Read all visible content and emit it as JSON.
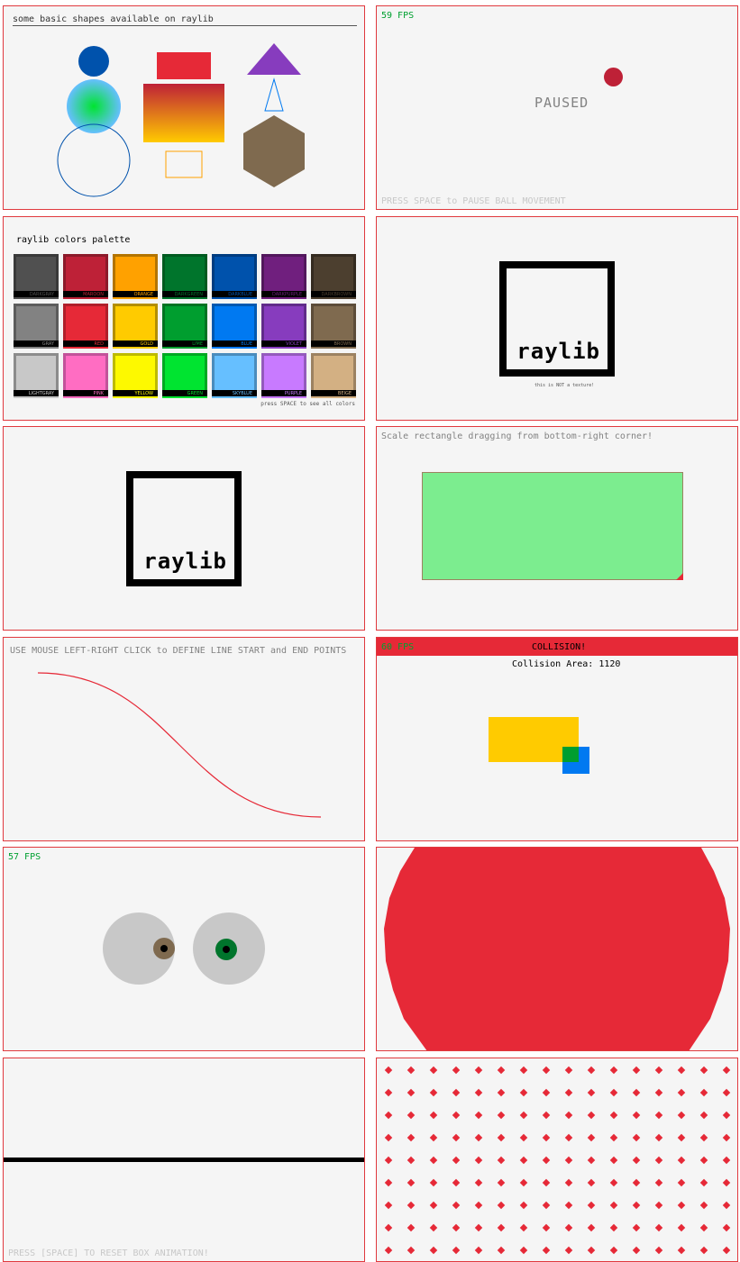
{
  "panels": {
    "shapes": {
      "title": "some basic shapes available on raylib"
    },
    "bouncing_ball": {
      "fps": "59 FPS",
      "paused": "PAUSED",
      "hint": "PRESS SPACE to PAUSE BALL MOVEMENT"
    },
    "palette": {
      "title": "raylib colors palette",
      "hint": "press SPACE to see all colors",
      "colors": [
        {
          "name": "DARKGRAY",
          "fill": "#505050",
          "border": "#3a3a3a",
          "label_color": "#505050"
        },
        {
          "name": "MAROON",
          "fill": "#be2137",
          "border": "#8c1a2a",
          "label_color": "#be2137"
        },
        {
          "name": "ORANGE",
          "fill": "#ffa100",
          "border": "#b37400",
          "label_color": "#ffa100"
        },
        {
          "name": "DARKGREEN",
          "fill": "#00752c",
          "border": "#005a20",
          "label_color": "#00752c"
        },
        {
          "name": "DARKBLUE",
          "fill": "#0052ac",
          "border": "#003c80",
          "label_color": "#0052ac"
        },
        {
          "name": "DARKPURPLE",
          "fill": "#701f7e",
          "border": "#52175c",
          "label_color": "#701f7e"
        },
        {
          "name": "DARKBROWN",
          "fill": "#4c3f2f",
          "border": "#342b20",
          "label_color": "#4c3f2f"
        },
        {
          "name": "GRAY",
          "fill": "#828282",
          "border": "#5c5c5c",
          "label_color": "#828282"
        },
        {
          "name": "RED",
          "fill": "#e62937",
          "border": "#b01f2a",
          "label_color": "#e62937"
        },
        {
          "name": "GOLD",
          "fill": "#ffcb00",
          "border": "#b38e00",
          "label_color": "#ffcb00"
        },
        {
          "name": "LIME",
          "fill": "#009e2f",
          "border": "#007322",
          "label_color": "#009e2f"
        },
        {
          "name": "BLUE",
          "fill": "#0079f1",
          "border": "#0058b0",
          "label_color": "#0079f1"
        },
        {
          "name": "VIOLET",
          "fill": "#873cbe",
          "border": "#612b8a",
          "label_color": "#873cbe"
        },
        {
          "name": "BROWN",
          "fill": "#7f6a4f",
          "border": "#5c4c39",
          "label_color": "#7f6a4f"
        },
        {
          "name": "LIGHTGRAY",
          "fill": "#c8c8c8",
          "border": "#8c8c8c",
          "label_color": "#c8c8c8"
        },
        {
          "name": "PINK",
          "fill": "#ff6dc2",
          "border": "#c2539a",
          "label_color": "#ff6dc2"
        },
        {
          "name": "YELLOW",
          "fill": "#fdf900",
          "border": "#bdba00",
          "label_color": "#fdf900"
        },
        {
          "name": "GREEN",
          "fill": "#00e430",
          "border": "#00a822",
          "label_color": "#00e430"
        },
        {
          "name": "SKYBLUE",
          "fill": "#66bfff",
          "border": "#4a8cbd",
          "label_color": "#66bfff"
        },
        {
          "name": "PURPLE",
          "fill": "#c87aff",
          "border": "#945abd",
          "label_color": "#c87aff"
        },
        {
          "name": "BEIGE",
          "fill": "#d3b083",
          "border": "#9c8261",
          "label_color": "#d3b083"
        }
      ]
    },
    "logo_small": {
      "logo_text": "raylib",
      "caption": "this is NOT a texture!"
    },
    "logo_big": {
      "logo_text": "raylib"
    },
    "scale_rect": {
      "title": "Scale rectangle dragging from bottom-right corner!"
    },
    "bezier": {
      "title": "USE MOUSE LEFT-RIGHT CLICK to DEFINE LINE START and END POINTS"
    },
    "collision": {
      "fps": "60 FPS",
      "banner": "COLLISION!",
      "area_label": "Collision Area: 1120"
    },
    "eyes": {
      "fps": "57 FPS"
    },
    "box_anim": {
      "hint": "PRESS [SPACE] TO RESET BOX ANIMATION!"
    }
  },
  "colors": {
    "panel_bg": "#f5f5f5",
    "panel_border": "#e0393e",
    "raylib_red": "#e62937",
    "fps_green": "#00a030",
    "hint_gray": "#c8c8c8"
  }
}
